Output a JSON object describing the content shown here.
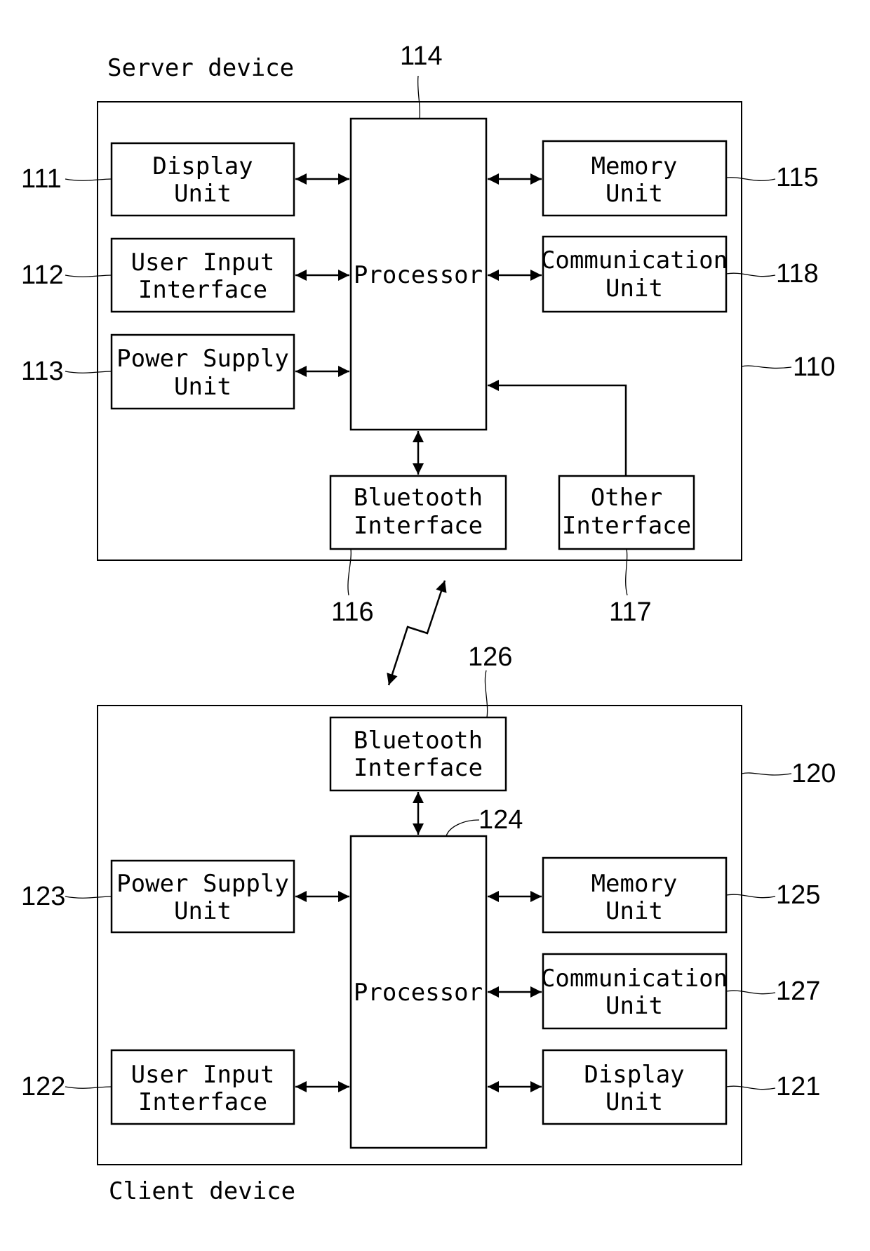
{
  "server": {
    "title": "Server device",
    "ref": "110",
    "processor": {
      "label": "Processor",
      "ref": "114"
    },
    "blocks": [
      {
        "id": "display",
        "line1": "Display",
        "line2": "Unit",
        "ref": "111"
      },
      {
        "id": "user-input",
        "line1": "User Input",
        "line2": "Interface",
        "ref": "112"
      },
      {
        "id": "power-supply",
        "line1": "Power Supply",
        "line2": "Unit",
        "ref": "113"
      },
      {
        "id": "memory",
        "line1": "Memory",
        "line2": "Unit",
        "ref": "115"
      },
      {
        "id": "communication",
        "line1": "Communication",
        "line2": "Unit",
        "ref": "118"
      },
      {
        "id": "bluetooth",
        "line1": "Bluetooth",
        "line2": "Interface",
        "ref": "116"
      },
      {
        "id": "other",
        "line1": "Other",
        "line2": "Interface",
        "ref": "117"
      }
    ]
  },
  "client": {
    "title": "Client device",
    "ref": "120",
    "processor": {
      "label": "Processor",
      "ref": "124"
    },
    "blocks": [
      {
        "id": "bluetooth",
        "line1": "Bluetooth",
        "line2": "Interface",
        "ref": "126"
      },
      {
        "id": "power-supply",
        "line1": "Power Supply",
        "line2": "Unit",
        "ref": "123"
      },
      {
        "id": "user-input",
        "line1": "User Input",
        "line2": "Interface",
        "ref": "122"
      },
      {
        "id": "memory",
        "line1": "Memory",
        "line2": "Unit",
        "ref": "125"
      },
      {
        "id": "communication",
        "line1": "Communication",
        "line2": "Unit",
        "ref": "127"
      },
      {
        "id": "display",
        "line1": "Display",
        "line2": "Unit",
        "ref": "121"
      }
    ]
  },
  "link": {
    "type": "wireless",
    "icon": "lightning-bidirectional-arrow-icon"
  }
}
